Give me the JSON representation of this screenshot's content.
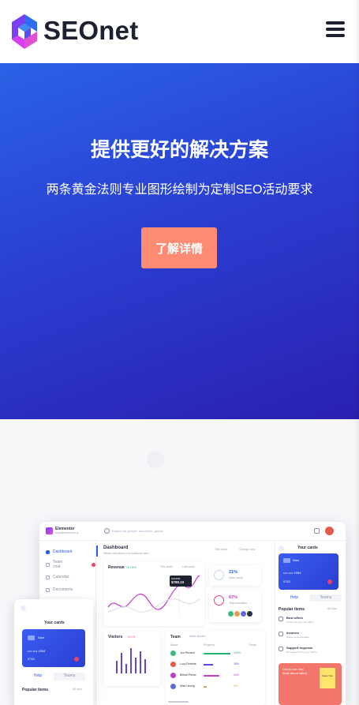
{
  "header": {
    "brand": "SEOnet",
    "logo_icon": "seonet-logo-icon",
    "menu_icon": "hamburger-menu-icon"
  },
  "hero": {
    "title": "提供更好的解决方案",
    "subtitle": "两条黄金法则专业图形绘制为定制SEO活动要求",
    "cta_label": "了解详情",
    "colors": {
      "gradient_start": "#2a62e6",
      "gradient_end": "#2a1fb0",
      "cta": "#fd8a72"
    }
  },
  "dashboard_mock": {
    "app_name": "Elementor",
    "app_sub": "user@elementor.io",
    "search_placeholder": "Search for people, document, goods...",
    "page_title": "Dashboard",
    "page_sub": "Whats new about your business here",
    "filter_week": "This week",
    "filter_view": "Change view",
    "sidebar": [
      "Dashboard",
      "Team chat",
      "Calendar",
      "Documents"
    ],
    "revenue_title": "Revenue",
    "revenue_change": "+10.5%",
    "revenue_this_week": "This week",
    "revenue_last_week": "Last week",
    "revenue_tooltip_label": "Income",
    "revenue_tooltip_value": "$780.10",
    "sales_percent": "21%",
    "sales_label": "Sales done",
    "team_percent": "67%",
    "team_label": "Team activities",
    "visitors_title": "Visitors",
    "visitors_change": "+0.73",
    "team_title": "Team",
    "team_filter": "Sales Boston",
    "team_cols": [
      "Name",
      "Progress",
      "Deals"
    ],
    "team_rows": [
      {
        "name": "Jon Richard",
        "pct": "100%"
      },
      {
        "name": "Lucy Roberts",
        "pct": "18%"
      },
      {
        "name": "Bilhah Pierce",
        "pct": "44%"
      },
      {
        "name": "Mike Hering",
        "pct": "2%"
      }
    ],
    "cards_title": "Your cards",
    "card_brand": "Saint",
    "card_number": "•••• •••• 1954",
    "card_expiry": "07/23",
    "seg_help": "Help",
    "seg_teams": "Teams",
    "popular_title": "Popular items",
    "popular_link": "All food",
    "popular_items": [
      {
        "title": "Best offers",
        "sub": "Check out new new offers"
      },
      {
        "title": "Invoices",
        "sub": "Where documentation"
      },
      {
        "title": "Support requests",
        "sub": "56 requests from your clients"
      }
    ],
    "promo_text": "Check our new book about sales!",
    "promo_book": "Sales Tips"
  },
  "phone_mock": {
    "cards_title": "Your cards",
    "card_brand": "Saint",
    "card_number": "•••• •••• 1954",
    "card_expiry": "07/23",
    "seg_help": "Help",
    "seg_teams": "Teams",
    "popular_title": "Popular items",
    "popular_link": "All food"
  }
}
